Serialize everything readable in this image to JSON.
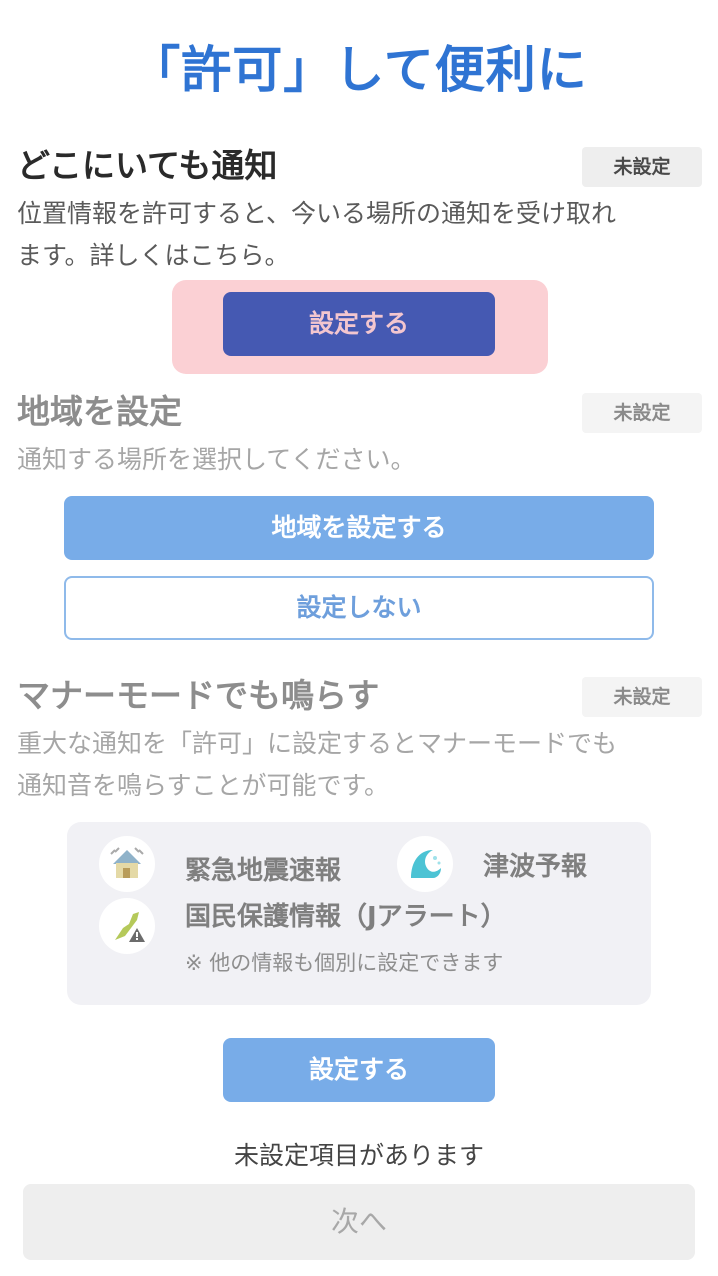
{
  "header": {
    "title": "「許可」して便利に"
  },
  "section1": {
    "title": "どこにいても通知",
    "badge": "未設定",
    "desc_line1": "位置情報を許可すると、今いる場所の通知を受け取れ",
    "desc_line2": "ます。詳しくはこちら。",
    "button": "設定する"
  },
  "section2": {
    "title": "地域を設定",
    "badge": "未設定",
    "desc": "通知する場所を選択してください。",
    "primary_button": "地域を設定する",
    "secondary_button": "設定しない"
  },
  "section3": {
    "title": "マナーモードでも鳴らす",
    "badge": "未設定",
    "desc_line1": "重大な通知を「許可」に設定するとマナーモードでも",
    "desc_line2": "通知音を鳴らすことが可能です。",
    "items": {
      "earthquake": "緊急地震速報",
      "tsunami": "津波予報",
      "jalert": "国民保護情報（Jアラート）"
    },
    "note": "※ 他の情報も個別に設定できます",
    "button": "設定する"
  },
  "footer": {
    "status": "未設定項目があります",
    "next_button": "次へ"
  },
  "colors": {
    "accent": "#2f74d3",
    "primary_button": "#4559b2",
    "highlight": "#fbd0d4",
    "light_button": "#78ace8",
    "disabled_button": "#eeeeee"
  }
}
